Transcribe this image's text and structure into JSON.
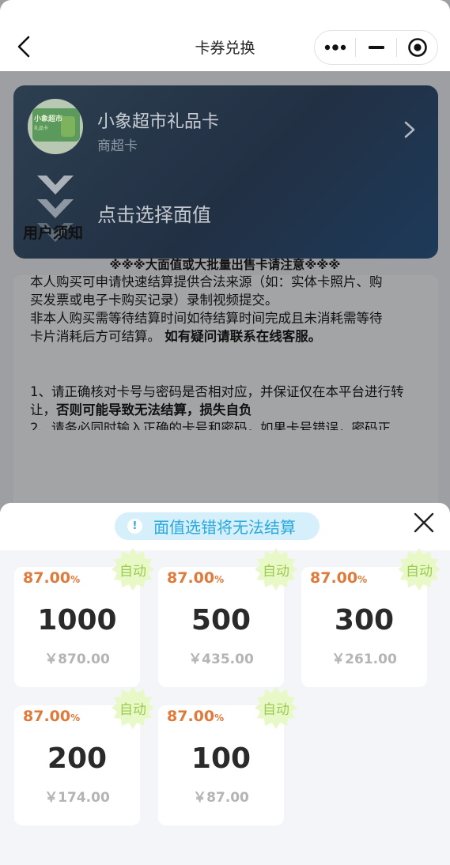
{
  "header": {
    "title": "卡券兑换"
  },
  "card": {
    "name": "小象超市礼品卡",
    "type": "商超卡",
    "thumb_title": "小象超市",
    "thumb_sub": "礼品卡",
    "select_prompt": "点击选择面值"
  },
  "notice": {
    "title": "用户须知",
    "headline": "※※※大面值或大批量出售卡请注意※※※",
    "body_lines": [
      "本人购买可申请快速结算提供合法来源（如：实体卡照片、购",
      "买发票或电子卡购买记录）录制视频提交。",
      "非本人购买需等待结算时间如待结算时间完成且未消耗需等待",
      "卡片消耗后方可结算。"
    ],
    "body_bold": "如有疑问请联系在线客服。",
    "rule1": "1、请正确核对卡号与密码是否相对应，并保证仅在本平台进行转让，",
    "rule1_bold": "否则可能导致无法结算，损失自负",
    "rule2": "2、请务必同时输入正确的卡号和密码，如果卡号错误，密码正"
  },
  "sheet": {
    "warning": "面值选错将无法结算",
    "badge_label": "自动",
    "tiles": [
      {
        "rate": "87.00",
        "pct": "%",
        "face": "1000",
        "price": "￥870.00"
      },
      {
        "rate": "87.00",
        "pct": "%",
        "face": "500",
        "price": "￥435.00"
      },
      {
        "rate": "87.00",
        "pct": "%",
        "face": "300",
        "price": "￥261.00"
      },
      {
        "rate": "87.00",
        "pct": "%",
        "face": "200",
        "price": "￥174.00"
      },
      {
        "rate": "87.00",
        "pct": "%",
        "face": "100",
        "price": "￥87.00"
      }
    ]
  },
  "colors": {
    "rate": "#e07a3a",
    "warn": "#2aa8dc",
    "badge": "#e9f8c7"
  }
}
